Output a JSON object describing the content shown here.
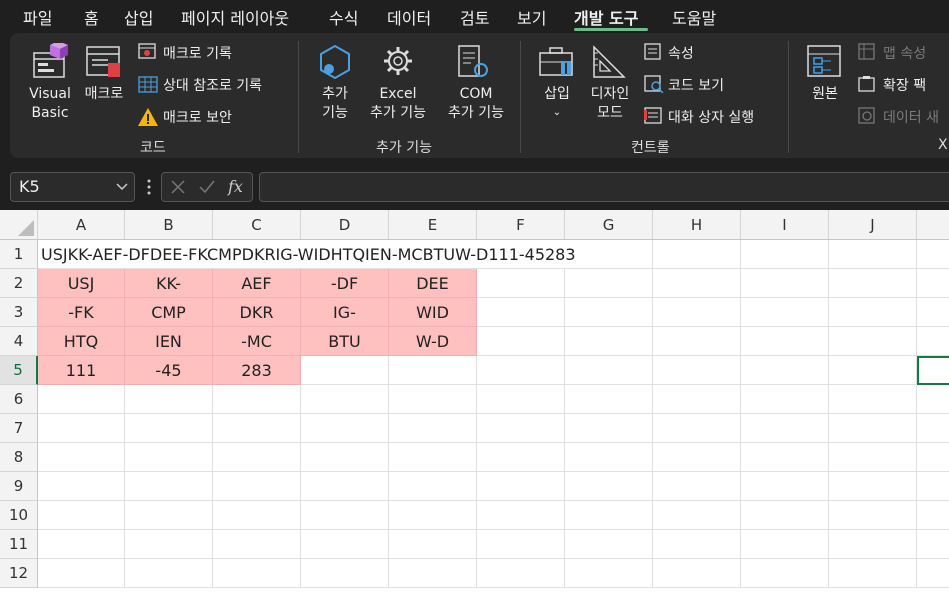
{
  "menu": [
    "파일",
    "홈",
    "삽입",
    "페이지 레이아웃",
    "수식",
    "데이터",
    "검토",
    "보기",
    "개발 도구",
    "도움말"
  ],
  "active_menu_index": 8,
  "ribbon": {
    "code": {
      "visual_basic": [
        "Visual",
        "Basic"
      ],
      "macro": "매크로",
      "record_macro": "매크로 기록",
      "relative_ref": "상대 참조로 기록",
      "macro_security": "매크로 보안",
      "label": "코드"
    },
    "addins": {
      "addins": [
        "추가",
        "기능"
      ],
      "excel_addins": [
        "Excel",
        "추가 기능"
      ],
      "com_addins": [
        "COM",
        "추가 기능"
      ],
      "label": "추가 기능"
    },
    "controls": {
      "insert": "삽입",
      "design_mode": [
        "디자인",
        "모드"
      ],
      "properties": "속성",
      "view_code": "코드 보기",
      "run_dialog": "대화 상자 실행",
      "label": "컨트롤"
    },
    "xml": {
      "source": "원본",
      "map_properties": "맵 속성",
      "expansion_packs": "확장 팩",
      "refresh_data": "데이터 새",
      "label": "X"
    }
  },
  "formula_bar": {
    "name_box": "K5",
    "formula": ""
  },
  "columns": [
    "A",
    "B",
    "C",
    "D",
    "E",
    "F",
    "G",
    "H",
    "I",
    "J"
  ],
  "rows": [
    "1",
    "2",
    "3",
    "4",
    "5",
    "6",
    "7",
    "8",
    "9",
    "10",
    "11",
    "12"
  ],
  "cells": {
    "A1": "USJKK-AEF-DFDEE-FKCMPDKRIG-WIDHTQIEN-MCBTUW-D111-45283",
    "A2": "USJ",
    "B2": "KK-",
    "C2": "AEF",
    "D2": "-DF",
    "E2": "DEE",
    "A3": "-FK",
    "B3": "CMP",
    "C3": "DKR",
    "D3": "IG-",
    "E3": "WID",
    "A4": "HTQ",
    "B4": "IEN",
    "C4": "-MC",
    "D4": "BTU",
    "E4": "W-D",
    "A5": "111",
    "B5": "-45",
    "C5": "283"
  },
  "colors": {
    "accent": "#107c41",
    "highlight_fill": "#ffc0c0"
  }
}
